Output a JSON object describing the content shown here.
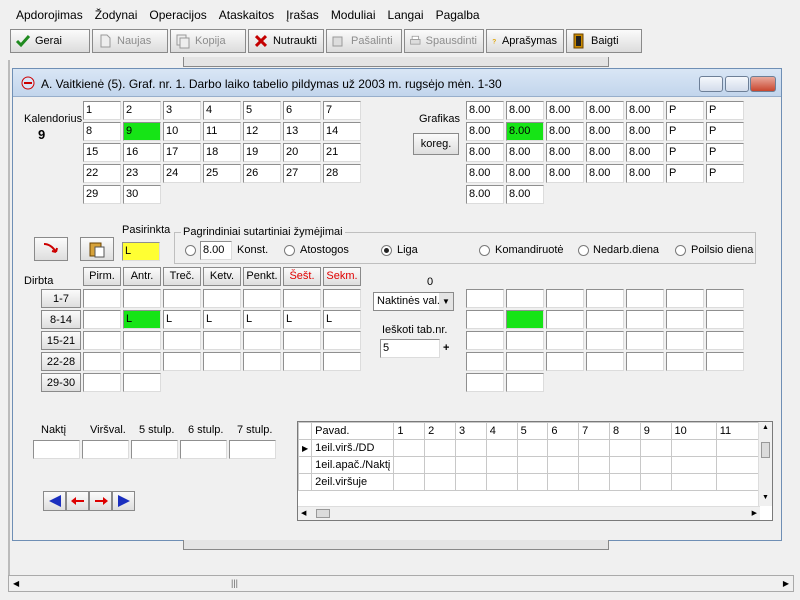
{
  "menu": [
    "Apdorojimas",
    "Žodynai",
    "Operacijos",
    "Ataskaitos",
    "Įrašas",
    "Moduliai",
    "Langai",
    "Pagalba"
  ],
  "toolbar": {
    "gerai": "Gerai",
    "naujas": "Naujas",
    "kopija": "Kopija",
    "nutraukti": "Nutraukti",
    "pasalinti": "Pašalinti",
    "spausdinti": "Spausdinti",
    "aprasymas": "Aprašymas",
    "baigti": "Baigti"
  },
  "window": {
    "title": "A. Vaitkienė (5). Graf. nr. 1. Darbo laiko tabelio pildymas už 2003 m. rugsėjo mėn. 1-30"
  },
  "calendar": {
    "label": "Kalendorius",
    "selected_day": "9",
    "days": [
      "1",
      "2",
      "3",
      "4",
      "5",
      "6",
      "7",
      "8",
      "9",
      "10",
      "11",
      "12",
      "13",
      "14",
      "15",
      "16",
      "17",
      "18",
      "19",
      "20",
      "21",
      "22",
      "23",
      "24",
      "25",
      "26",
      "27",
      "28",
      "29",
      "30"
    ]
  },
  "grafikas": {
    "label": "Grafikas",
    "koreg": "koreg.",
    "values": [
      "8.00",
      "8.00",
      "8.00",
      "8.00",
      "8.00",
      "P",
      "P",
      "8.00",
      "8.00",
      "8.00",
      "8.00",
      "8.00",
      "P",
      "P",
      "8.00",
      "8.00",
      "8.00",
      "8.00",
      "8.00",
      "P",
      "P",
      "8.00",
      "8.00",
      "8.00",
      "8.00",
      "8.00",
      "P",
      "P",
      "8.00",
      "8.00"
    ]
  },
  "pasirinkta": {
    "label": "Pasirinkta",
    "value": "L"
  },
  "pagrindiniai": {
    "legend": "Pagrindiniai sutartiniai žymėjimai",
    "konst_value": "8.00",
    "konst": "Konst.",
    "atostogos": "Atostogos",
    "liga": "Liga",
    "komandiruote": "Komandiruotė",
    "nedarb": "Nedarb.diena",
    "poilsio": "Poilsio diena"
  },
  "dirbta": {
    "label": "Dirbta",
    "weekdays": [
      "Pirm.",
      "Antr.",
      "Treč.",
      "Ketv.",
      "Penkt.",
      "Šešt.",
      "Sekm."
    ],
    "weeks": [
      "1-7",
      "8-14",
      "15-21",
      "22-28",
      "29-30"
    ],
    "row2": [
      "",
      "L",
      "L",
      "L",
      "L",
      "L",
      "L"
    ]
  },
  "middle": {
    "zero": "0",
    "dropdown": "Naktinės val.",
    "search_label": "Ieškoti tab.nr.",
    "search_value": "5",
    "plus": "+"
  },
  "bottom_labels": [
    "Naktį",
    "Viršval.",
    "5 stulp.",
    "6 stulp.",
    "7 stulp."
  ],
  "grid2": {
    "header": [
      "Pavad.",
      "1",
      "2",
      "3",
      "4",
      "5",
      "6",
      "7",
      "8",
      "9",
      "10",
      "11"
    ],
    "rows": [
      "1eil.virš./DD",
      "1eil.apač./Naktį",
      "2eil.viršuje"
    ]
  },
  "colors": {
    "selected": "#16e416",
    "highlight": "#ffff33",
    "weekend_header": "#e00000"
  }
}
